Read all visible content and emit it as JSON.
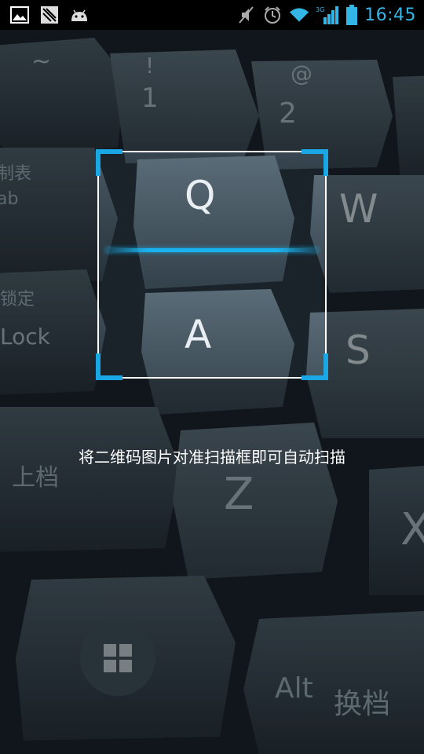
{
  "status_bar": {
    "time": "16:45",
    "network_type": "3G",
    "left_icons": [
      "gallery-icon",
      "signal-app-icon",
      "android-icon"
    ],
    "right_icons": [
      "mute-icon",
      "alarm-icon",
      "wifi-icon",
      "mobile-signal-icon",
      "battery-icon"
    ]
  },
  "scanner": {
    "hint": "将二维码图片对准扫描框即可自动扫描",
    "accent_color": "#1aa7e6"
  },
  "camera_preview": {
    "key_labels": [
      "~",
      "!",
      "1",
      "@",
      "2",
      "Q",
      "W",
      "A",
      "S",
      "Z",
      "X",
      "Lock",
      "锁定",
      "制表",
      "ab",
      "上档",
      "Alt",
      "换档"
    ]
  }
}
